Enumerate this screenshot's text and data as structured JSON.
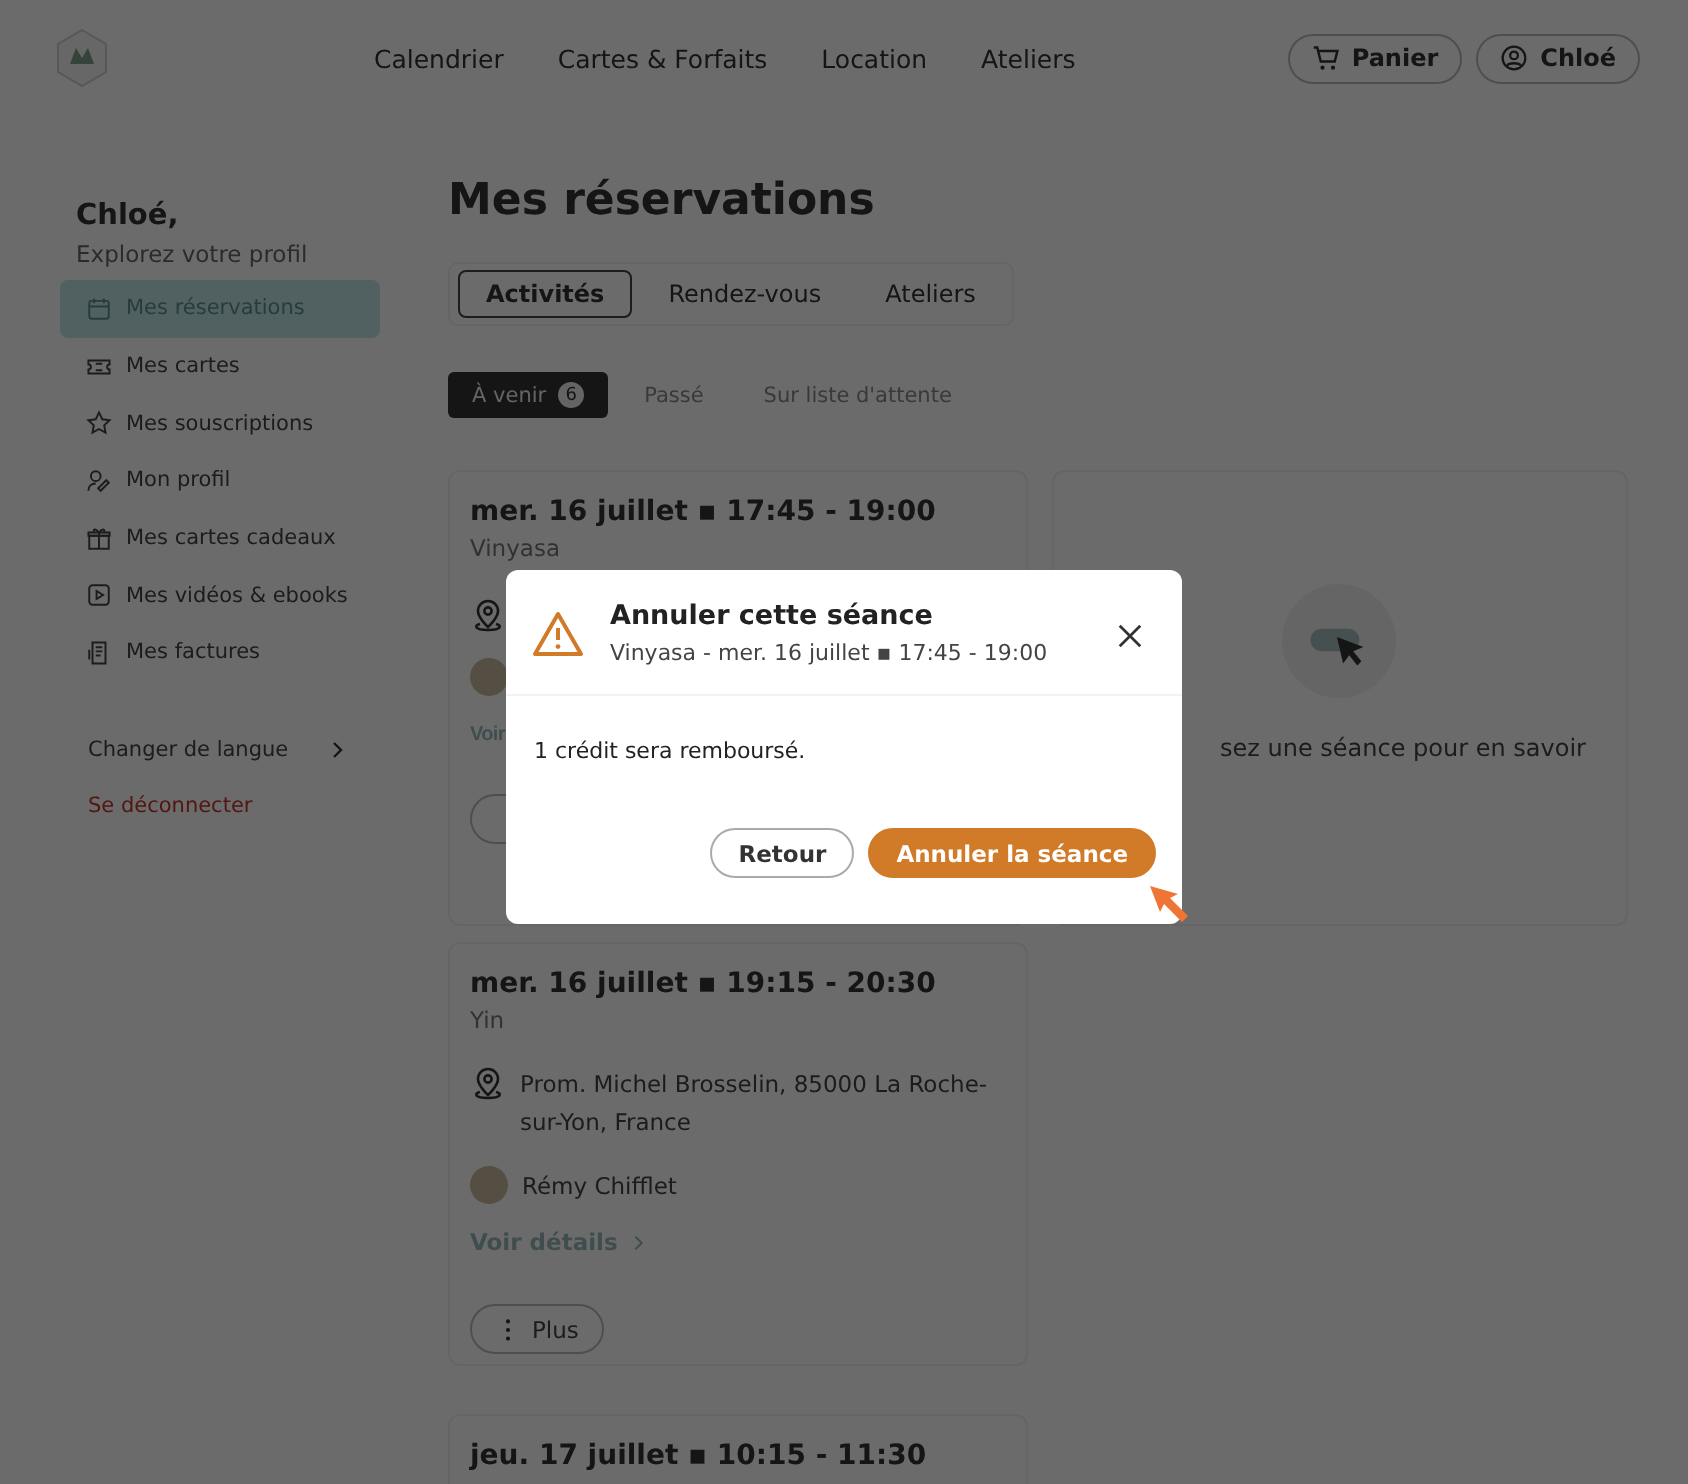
{
  "header": {
    "nav": [
      {
        "label": "Calendrier"
      },
      {
        "label": "Cartes & Forfaits"
      },
      {
        "label": "Location"
      },
      {
        "label": "Ateliers"
      }
    ],
    "cart_button": "Panier",
    "account_button": "Chloé"
  },
  "sidebar": {
    "greeting": "Chloé,",
    "subtitle": "Explorez votre profil",
    "items": [
      {
        "label": "Mes réservations",
        "selected": true
      },
      {
        "label": "Mes cartes",
        "selected": false
      },
      {
        "label": "Mes souscriptions",
        "selected": false
      },
      {
        "label": "Mon profil",
        "selected": false
      },
      {
        "label": "Mes cartes cadeaux",
        "selected": false
      },
      {
        "label": "Mes vidéos & ebooks",
        "selected": false
      },
      {
        "label": "Mes factures",
        "selected": false
      }
    ],
    "language": "Changer de langue",
    "logout": "Se déconnecter"
  },
  "main": {
    "title": "Mes réservations",
    "tabs": [
      {
        "label": "Activités",
        "selected": true
      },
      {
        "label": "Rendez-vous",
        "selected": false
      },
      {
        "label": "Ateliers",
        "selected": false
      }
    ],
    "filters": [
      {
        "label": "À venir",
        "count": "6",
        "selected": true
      },
      {
        "label": "Passé",
        "selected": false
      },
      {
        "label": "Sur liste d'attente",
        "selected": false
      }
    ],
    "cards": [
      {
        "when": "mer. 16 juillet ▪ 17:45 - 19:00",
        "activity": "Vinyasa",
        "kind": "covered",
        "details_link": "Voir"
      },
      {
        "when": "mer. 16 juillet ▪ 19:15 - 20:30",
        "activity": "Yin",
        "kind": "full",
        "location": "Prom. Michel Brosselin, 85000 La Roche-sur-Yon, France",
        "instructor": "Rémy Chifflet",
        "details_link": "Voir détails",
        "more_button": "Plus"
      },
      {
        "when": "jeu. 17 juillet ▪ 10:15 - 11:30",
        "kind": "full"
      }
    ],
    "detail_panel": {
      "hint": "sez une séance pour en savoir"
    }
  },
  "dialog": {
    "title": "Annuler cette séance",
    "subtitle": "Vinyasa - mer. 16 juillet ▪ 17:45 - 19:00",
    "message": "1 crédit sera remboursé.",
    "buttons": [
      {
        "label": "Retour",
        "kind": "secondary"
      },
      {
        "label": "Annuler la séance",
        "kind": "primary"
      }
    ]
  }
}
